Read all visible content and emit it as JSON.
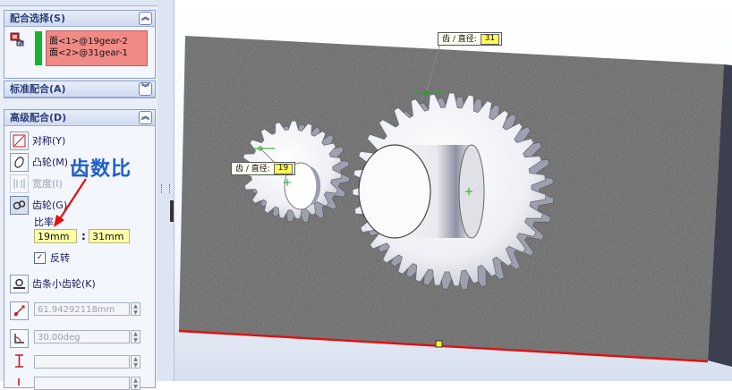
{
  "mate_selection": {
    "header": "配合选择(S)",
    "entities": [
      "面<1>@19gear-2",
      "面<2>@31gear-1"
    ]
  },
  "standard_mates": {
    "header": "标准配合(A)"
  },
  "advanced_mates": {
    "header": "高级配合(D)",
    "symmetric": "对称(Y)",
    "cam": "凸轮(M)",
    "width": "宽度(I)",
    "gear": "齿轮(G)",
    "ratio_label": "比率",
    "ratio_left": "19mm",
    "ratio_sep": ":",
    "ratio_right": "31mm",
    "reverse_label": "反转",
    "rack_pinion": "齿条小齿轮(K)",
    "distance_value": "61.94292118mm",
    "angle_value": "30.00deg"
  },
  "annotation": {
    "text": "齿数比",
    "color": "#1f5fc8"
  },
  "viewport": {
    "callout_large_label": "齿 / 直径:",
    "callout_large_value": "31",
    "callout_small_label": "齿 / 直径:",
    "callout_small_value": "19"
  },
  "colors": {
    "entity_list_bg": "#f08a86",
    "selection_bar": "#17b52a",
    "edge_highlight": "#e01010",
    "input_yellow": "#ffffa8"
  },
  "icons": [
    "double-chevron-up-icon",
    "double-chevron-down-icon",
    "selection-icon",
    "symmetric-mate-icon",
    "cam-mate-icon",
    "width-mate-icon",
    "gear-mate-icon",
    "rack-pinion-icon",
    "distance-icon",
    "angle-icon",
    "limit-icon",
    "checkbox-checked-icon",
    "arrow-icon"
  ]
}
